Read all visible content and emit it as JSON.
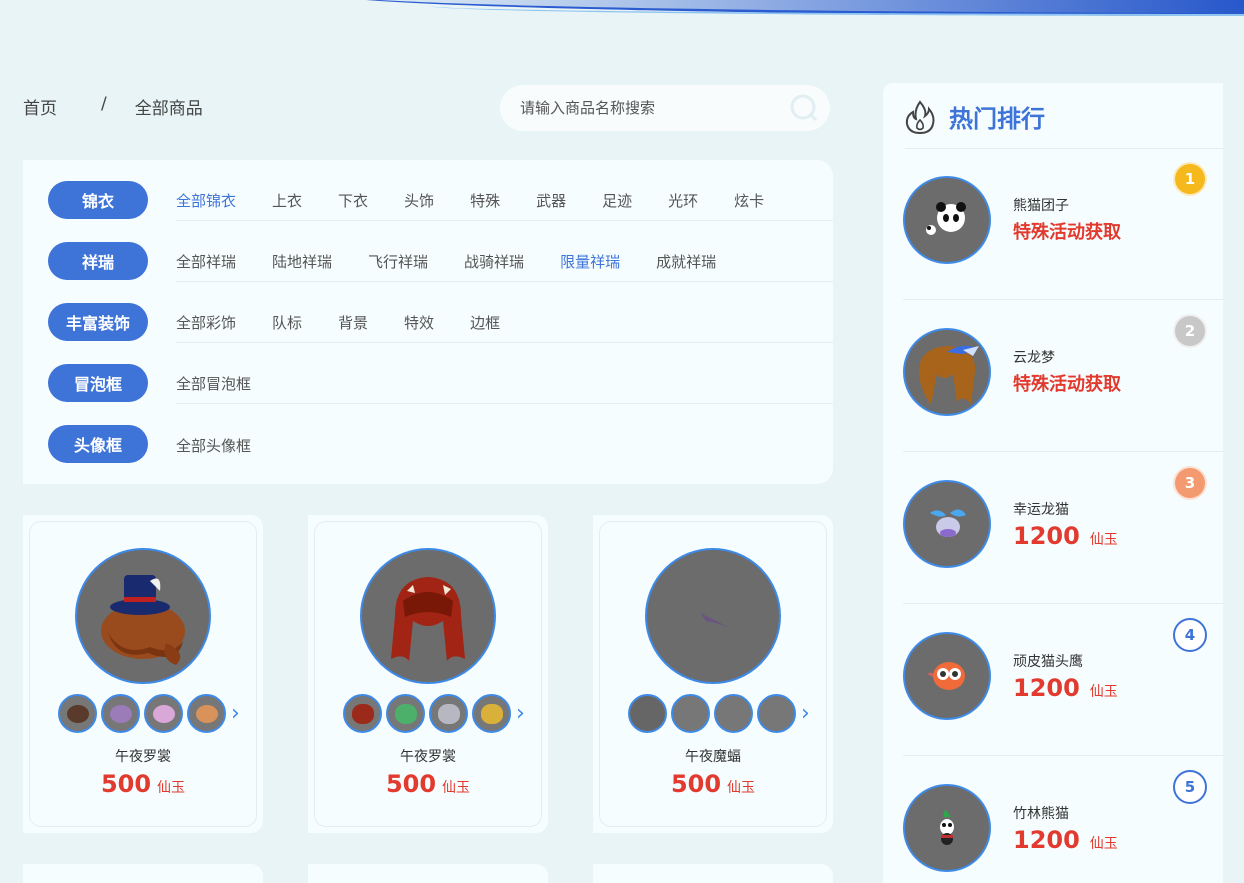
{
  "breadcrumb": {
    "home": "首页",
    "separator": "/",
    "current": "全部商品"
  },
  "search": {
    "placeholder": "请输入商品名称搜索"
  },
  "categories": [
    {
      "label": "锦衣",
      "items": [
        "全部锦衣",
        "上衣",
        "下衣",
        "头饰",
        "特殊",
        "武器",
        "足迹",
        "光环",
        "炫卡"
      ],
      "active": 0
    },
    {
      "label": "祥瑞",
      "items": [
        "全部祥瑞",
        "陆地祥瑞",
        "飞行祥瑞",
        "战骑祥瑞",
        "限量祥瑞",
        "成就祥瑞"
      ],
      "active": 4
    },
    {
      "label": "丰富装饰",
      "items": [
        "全部彩饰",
        "队标",
        "背景",
        "特效",
        "边框"
      ],
      "active": -1
    },
    {
      "label": "冒泡框",
      "items": [
        "全部冒泡框"
      ],
      "active": -1
    },
    {
      "label": "头像框",
      "items": [
        "全部头像框"
      ],
      "active": -1
    }
  ],
  "products": [
    {
      "name": "午夜罗裳",
      "price": "500",
      "unit": "仙玉",
      "icon": "hat-hair-icon",
      "thumbs": [
        "#5a3a2a",
        "#9b7bb8",
        "#d9a7d8",
        "#d9925a"
      ]
    },
    {
      "name": "午夜罗裳",
      "price": "500",
      "unit": "仙玉",
      "icon": "red-hair-icon",
      "thumbs": [
        "#9b2a1a",
        "#4caf6a",
        "#b7b7c2",
        "#d9b03a"
      ]
    },
    {
      "name": "午夜魔蝠",
      "price": "500",
      "unit": "仙玉",
      "icon": "bat-icon",
      "thumbs": [
        "#666666",
        "#777777",
        "#777777",
        "#777777"
      ]
    }
  ],
  "ranking": {
    "title": "热门排行",
    "items": [
      {
        "rank": "1",
        "name": "熊猫团子",
        "special": "特殊活动获取",
        "badge_color": "#f5b91e",
        "icon": "panda-icon"
      },
      {
        "rank": "2",
        "name": "云龙梦",
        "special": "特殊活动获取",
        "badge_color": "#c8c8c8",
        "icon": "dragon-hair-icon"
      },
      {
        "rank": "3",
        "name": "幸运龙猫",
        "price": "1200",
        "unit": "仙玉",
        "badge_color": "#f49a70",
        "icon": "lucky-cat-icon"
      },
      {
        "rank": "4",
        "name": "顽皮猫头鹰",
        "price": "1200",
        "unit": "仙玉",
        "icon": "owl-icon"
      },
      {
        "rank": "5",
        "name": "竹林熊猫",
        "price": "1200",
        "unit": "仙玉",
        "icon": "bamboo-panda-icon"
      }
    ]
  },
  "colors": {
    "accent": "#3e74d8",
    "price": "#e23a2e",
    "ring": "#3e8ae8"
  }
}
